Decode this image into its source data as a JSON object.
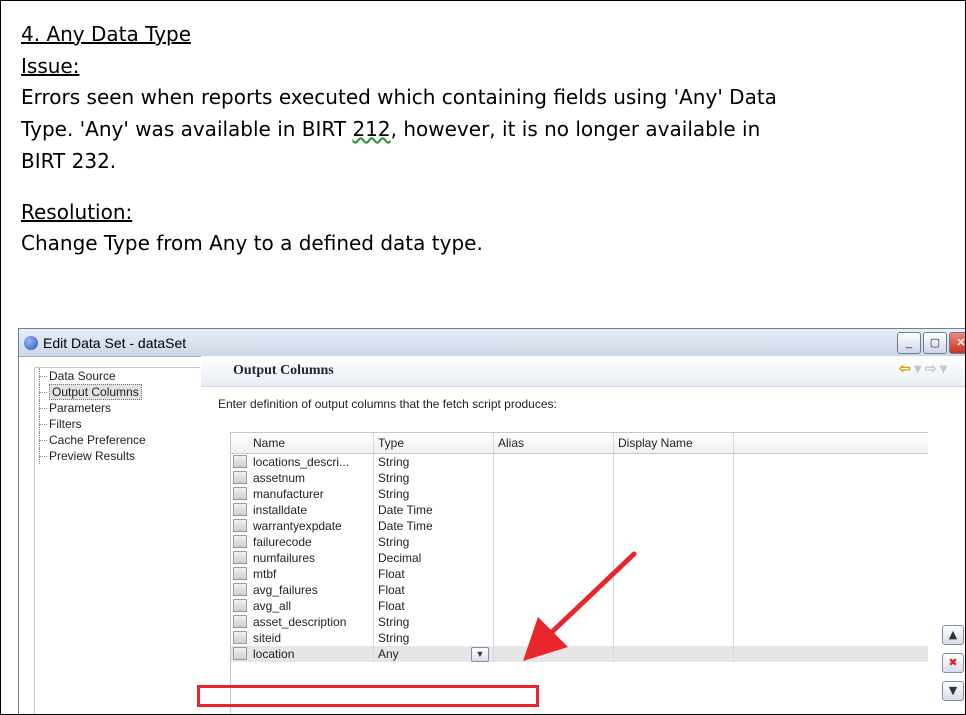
{
  "document": {
    "heading": "4.  Any Data Type",
    "issue_label": "Issue:",
    "issue_line1": "Errors seen when reports executed which containing fields using 'Any' Data",
    "issue_line2_a": "Type.  'Any' was available in BIRT ",
    "issue_line2_b": "212",
    "issue_line2_c": ", however, it is no longer available in",
    "issue_line3": "BIRT 232.",
    "resolution_label": "Resolution:",
    "resolution_text": "Change Type from Any to a defined data type."
  },
  "dialog": {
    "title": "Edit Data Set - dataSet",
    "nav_items": [
      "Data Source",
      "Output Columns",
      "Parameters",
      "Filters",
      "Cache Preference",
      "Preview Results"
    ],
    "selected_nav": "Output Columns",
    "section_title": "Output Columns",
    "description": "Enter definition of output columns that the fetch script produces:",
    "columns": [
      "Name",
      "Type",
      "Alias",
      "Display Name"
    ],
    "rows": [
      {
        "name": "locations_descri...",
        "type": "String"
      },
      {
        "name": "assetnum",
        "type": "String"
      },
      {
        "name": "manufacturer",
        "type": "String"
      },
      {
        "name": "installdate",
        "type": "Date Time"
      },
      {
        "name": "warrantyexpdate",
        "type": "Date Time"
      },
      {
        "name": "failurecode",
        "type": "String"
      },
      {
        "name": "numfailures",
        "type": "Decimal"
      },
      {
        "name": "mtbf",
        "type": "Float"
      },
      {
        "name": "avg_failures",
        "type": "Float"
      },
      {
        "name": "avg_all",
        "type": "Float"
      },
      {
        "name": "asset_description",
        "type": "String"
      },
      {
        "name": "siteid",
        "type": "String"
      },
      {
        "name": "location",
        "type": "Any"
      }
    ]
  },
  "colors": {
    "annotation_red": "#e8262b"
  }
}
